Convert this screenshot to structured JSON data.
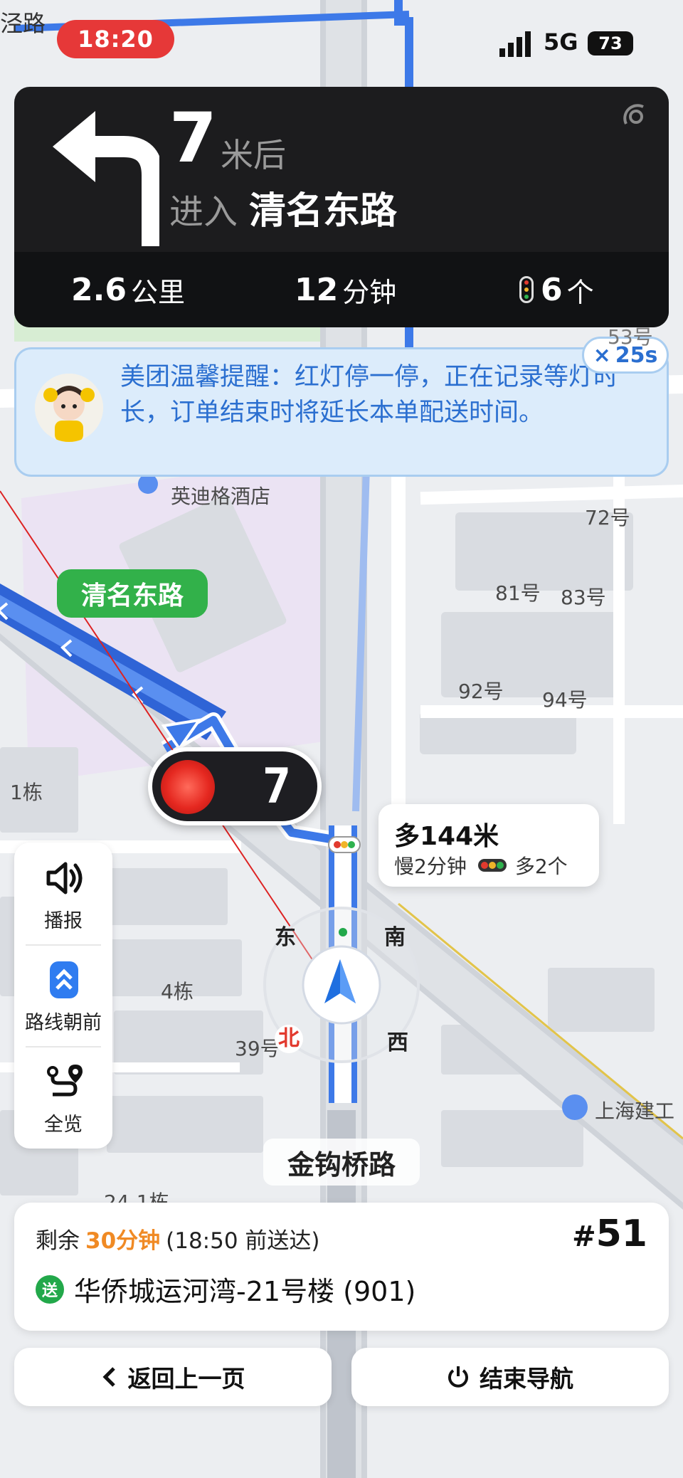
{
  "status_bar": {
    "time": "18:20",
    "network": "5G",
    "battery": "73"
  },
  "map_top_road": "泾路",
  "navigation": {
    "distance": "7",
    "distance_unit": "米后",
    "action": "进入",
    "road": "清名东路",
    "remaining_distance": "2.6",
    "remaining_distance_unit": "公里",
    "remaining_time": "12",
    "remaining_time_unit": "分钟",
    "traffic_lights": "6",
    "traffic_lights_unit": "个"
  },
  "reminder": {
    "text": "美团温馨提醒：红灯停一停，正在记录等灯时长，订单结束时将延长本单配送时间。",
    "close_icon": "×",
    "timer": "25s"
  },
  "map": {
    "road_bubble": "清名东路",
    "light_countdown": "7",
    "detour": {
      "extra_distance": "多144米",
      "slower": "慢2分钟",
      "extra_lights": "多2个"
    },
    "labels": {
      "hotel": "英迪格酒店",
      "no72": "72号",
      "no81": "81号",
      "no83": "83号",
      "no92": "92号",
      "no94": "94号",
      "no53": "53号",
      "bldg1": "1栋",
      "bldg4": "4栋",
      "no39": "39号",
      "bldg24": "24-1栋",
      "shanghai": "上海建工"
    },
    "compass": {
      "east": "东",
      "south": "南",
      "west": "西",
      "north": "北"
    },
    "street": "金钩桥路"
  },
  "side_controls": [
    {
      "label": "播报",
      "icon": "speaker-icon"
    },
    {
      "label": "路线朝前",
      "icon": "route-forward-icon"
    },
    {
      "label": "全览",
      "icon": "overview-icon"
    }
  ],
  "order": {
    "remaining_label": "剩余",
    "remaining_time": "30分钟",
    "deadline": "(18:50 前送达)",
    "number": "51",
    "number_prefix": "#",
    "badge": "送",
    "address": "华侨城运河湾-21号楼 (901)"
  },
  "buttons": {
    "back": "返回上一页",
    "end": "结束导航"
  },
  "colors": {
    "route_blue": "#3d79e8",
    "bubble_green": "#32b14a",
    "alert_red": "#e63838",
    "accent_orange": "#f08a24"
  }
}
